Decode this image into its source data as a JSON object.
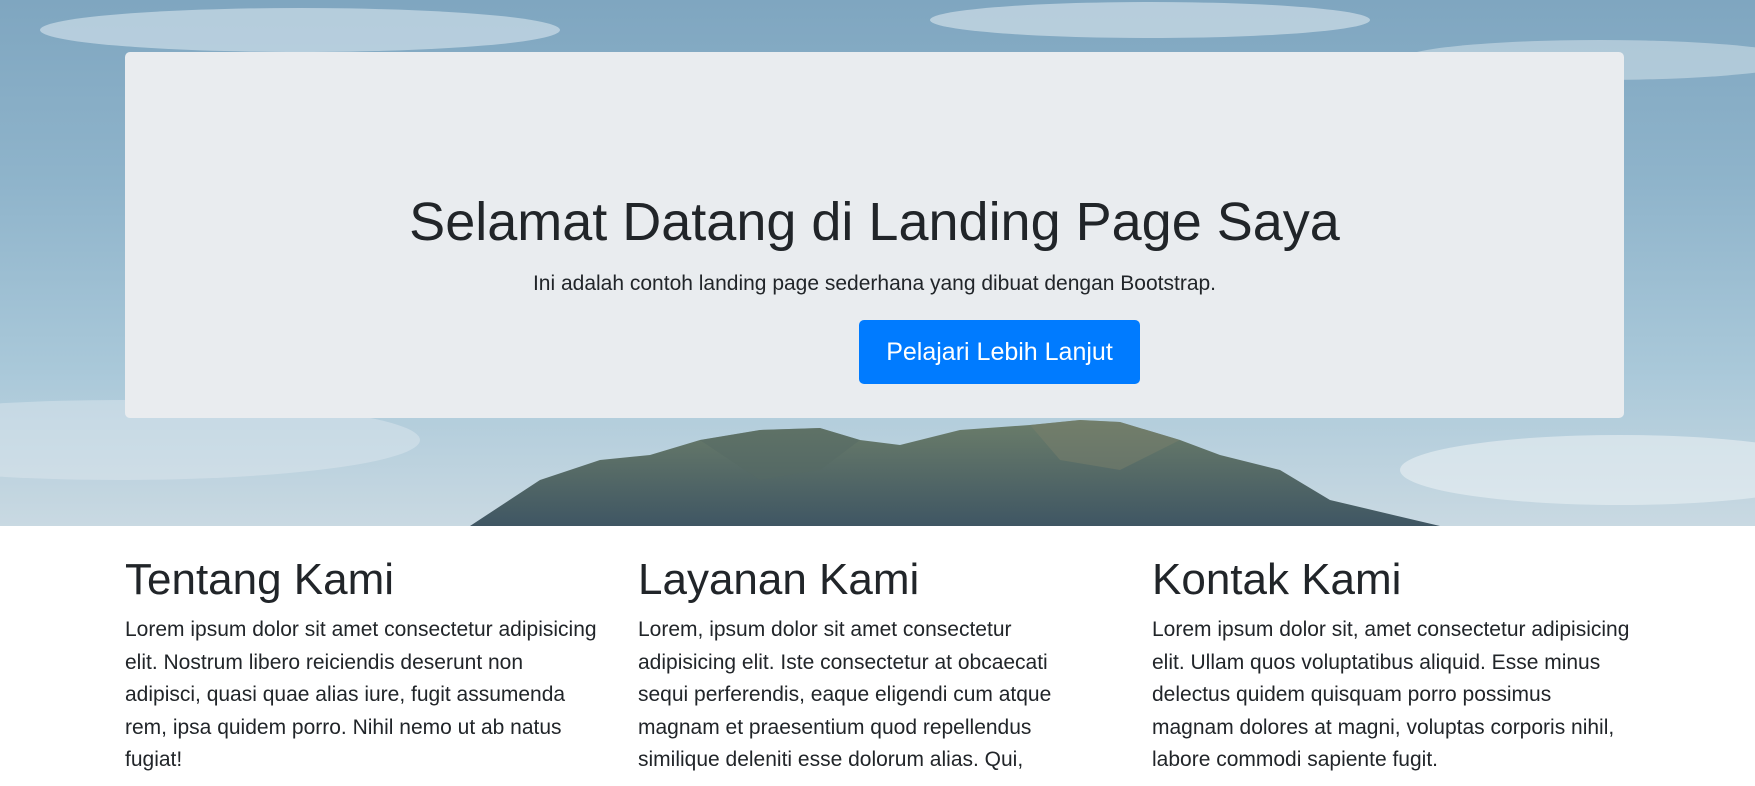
{
  "hero": {
    "title": "Selamat Datang di Landing Page Saya",
    "lead": "Ini adalah contoh landing page sederhana yang dibuat dengan Bootstrap.",
    "button_label": "Pelajari Lebih Lanjut",
    "button_color": "#007bff",
    "panel_color": "#e9ecef"
  },
  "sections": {
    "about": {
      "title": "Tentang Kami",
      "text": "Lorem ipsum dolor sit amet consectetur adipisicing elit. Nostrum libero reiciendis deserunt non adipisci, quasi quae alias iure, fugit assumenda rem, ipsa quidem porro. Nihil nemo ut ab natus fugiat!"
    },
    "services": {
      "title": "Layanan Kami",
      "text": "Lorem, ipsum dolor sit amet consectetur adipisicing elit. Iste consectetur at obcaecati sequi perferendis, eaque eligendi cum atque magnam et praesentium quod repellendus similique deleniti esse dolorum alias. Qui,"
    },
    "contact": {
      "title": "Kontak Kami",
      "text": "Lorem ipsum dolor sit, amet consectetur adipisicing elit. Ullam quos voluptatibus aliquid. Esse minus delectus quidem quisquam porro possimus magnam dolores at magni, voluptas corporis nihil, labore commodi sapiente fugit."
    }
  }
}
